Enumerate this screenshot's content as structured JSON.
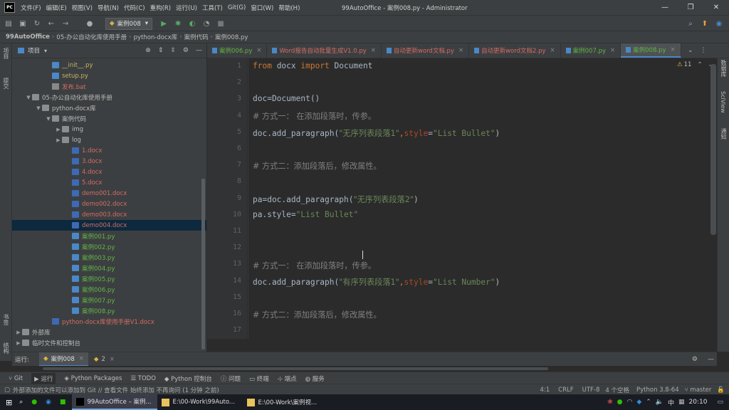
{
  "titlebar": {
    "app_badge": "PC",
    "menu": [
      "文件(F)",
      "编辑(E)",
      "视图(V)",
      "导航(N)",
      "代码(C)",
      "重构(R)",
      "运行(U)",
      "工具(T)",
      "Git(G)",
      "窗口(W)",
      "帮助(H)"
    ],
    "window_title": "99AutoOffice - 案例008.py - Administrator"
  },
  "toolbar": {
    "run_config": "案例008"
  },
  "breadcrumb": [
    "99AutoOffice",
    "05-办公自动化库使用手册",
    "python-docx库",
    "案例代码",
    "案例008.py"
  ],
  "leftstrip": {
    "top_label": "项目",
    "mid_label": "提交",
    "bottom_label1": "书签",
    "bottom_label2": "结构"
  },
  "project": {
    "title": "项目",
    "tree": [
      {
        "label": "__init__.py",
        "indent": 3,
        "type": "py",
        "color": "yellow",
        "arrow": ""
      },
      {
        "label": "setup.py",
        "indent": 3,
        "type": "py",
        "color": "yellow",
        "arrow": ""
      },
      {
        "label": "发布.bat",
        "indent": 3,
        "type": "bat",
        "color": "red",
        "arrow": ""
      },
      {
        "label": "05-办公自动化库使用手册",
        "indent": 1,
        "type": "folder",
        "color": "white",
        "arrow": "▼"
      },
      {
        "label": "python-docx库",
        "indent": 2,
        "type": "folder",
        "color": "white",
        "arrow": "▼"
      },
      {
        "label": "案例代码",
        "indent": 3,
        "type": "folder",
        "color": "white",
        "arrow": "▼"
      },
      {
        "label": "img",
        "indent": 4,
        "type": "folder",
        "color": "white",
        "arrow": "▶"
      },
      {
        "label": "log",
        "indent": 4,
        "type": "folder",
        "color": "white",
        "arrow": "▶"
      },
      {
        "label": "1.docx",
        "indent": 5,
        "type": "doc",
        "color": "red",
        "arrow": ""
      },
      {
        "label": "3.docx",
        "indent": 5,
        "type": "doc",
        "color": "red",
        "arrow": ""
      },
      {
        "label": "4.docx",
        "indent": 5,
        "type": "doc",
        "color": "red",
        "arrow": ""
      },
      {
        "label": "5.docx",
        "indent": 5,
        "type": "doc",
        "color": "red",
        "arrow": ""
      },
      {
        "label": "demo001.docx",
        "indent": 5,
        "type": "doc",
        "color": "red",
        "arrow": ""
      },
      {
        "label": "demo002.docx",
        "indent": 5,
        "type": "doc",
        "color": "red",
        "arrow": ""
      },
      {
        "label": "demo003.docx",
        "indent": 5,
        "type": "doc",
        "color": "red",
        "arrow": ""
      },
      {
        "label": "demo004.docx",
        "indent": 5,
        "type": "doc",
        "color": "red",
        "arrow": "",
        "selected": true
      },
      {
        "label": "案例001.py",
        "indent": 5,
        "type": "py",
        "color": "green",
        "arrow": ""
      },
      {
        "label": "案例002.py",
        "indent": 5,
        "type": "py",
        "color": "green",
        "arrow": ""
      },
      {
        "label": "案例003.py",
        "indent": 5,
        "type": "py",
        "color": "green",
        "arrow": ""
      },
      {
        "label": "案例004.py",
        "indent": 5,
        "type": "py",
        "color": "green",
        "arrow": ""
      },
      {
        "label": "案例005.py",
        "indent": 5,
        "type": "py",
        "color": "green",
        "arrow": ""
      },
      {
        "label": "案例006.py",
        "indent": 5,
        "type": "py",
        "color": "green",
        "arrow": ""
      },
      {
        "label": "案例007.py",
        "indent": 5,
        "type": "py",
        "color": "green",
        "arrow": ""
      },
      {
        "label": "案例008.py",
        "indent": 5,
        "type": "py",
        "color": "green",
        "arrow": ""
      },
      {
        "label": "python-docx库使用手册V1.docx",
        "indent": 3,
        "type": "doc",
        "color": "red",
        "arrow": ""
      },
      {
        "label": "外部库",
        "indent": 0,
        "type": "folder",
        "color": "white",
        "arrow": "▶"
      },
      {
        "label": "临时文件和控制台",
        "indent": 0,
        "type": "folder",
        "color": "white",
        "arrow": "▶"
      }
    ]
  },
  "tabs": [
    {
      "label": "案例006.py",
      "color": "green",
      "active": false
    },
    {
      "label": "Word报告自动批量生成V1.0.py",
      "color": "red",
      "active": false
    },
    {
      "label": "自动更新word文档.py",
      "color": "red",
      "active": false
    },
    {
      "label": "自动更新word文档2.py",
      "color": "red",
      "active": false
    },
    {
      "label": "案例007.py",
      "color": "green",
      "active": false
    },
    {
      "label": "案例008.py",
      "color": "green",
      "active": true
    }
  ],
  "editor": {
    "warning_count": "11",
    "line_numbers": [
      "1",
      "2",
      "3",
      "4",
      "5",
      "6",
      "7",
      "8",
      "9",
      "10",
      "11",
      "12",
      "13",
      "14",
      "15",
      "16",
      "17"
    ]
  },
  "code": {
    "l1_from": "from",
    "l1_mod": " docx ",
    "l1_import": "import",
    "l1_name": " Document",
    "l3": "doc=Document()",
    "l4": "# 方式一： 在添加段落时，传参。",
    "l5_a": "doc.add_paragraph(",
    "l5_s1": "\"无序列表段落1\"",
    "l5_c": ",",
    "l5_p": "style",
    "l5_e": "=",
    "l5_s2": "\"List Bullet\"",
    "l5_z": ")",
    "l7": "# 方式二：添加段落后，修改属性。",
    "l9_a": "pa=doc.add_paragraph(",
    "l9_s": "\"无序列表段落2\"",
    "l9_z": ")",
    "l10_a": "pa.style=",
    "l10_s": "\"List Bullet\"",
    "l13": "# 方式一： 在添加段落时，传参。",
    "l14_a": "doc.add_paragraph(",
    "l14_s1": "\"有序列表段落1\"",
    "l14_c": ",",
    "l14_p": "style",
    "l14_e": "=",
    "l14_s2": "\"List Number\"",
    "l14_z": ")",
    "l16": "# 方式二：添加段落后，修改属性。"
  },
  "rightstrip": {
    "label1": "数据库",
    "label2": "SciView",
    "label3": "通知"
  },
  "runbar": {
    "label": "运行:",
    "tab1": "案例008",
    "tab2": "2"
  },
  "tooltabs": [
    "Git",
    "运行",
    "Python Packages",
    "TODO",
    "Python 控制台",
    "问题",
    "终端",
    "端点",
    "服务"
  ],
  "statusbar": {
    "message": "外部添加的文件可以添加到 Git // 查看文件    始终添加    不再询问 (1 分钟 之前)",
    "position": "4:1",
    "line_sep": "CRLF",
    "encoding": "UTF-8",
    "indent": "4 个空格",
    "interpreter": "Python 3.8-64",
    "branch": "master"
  },
  "taskbar": {
    "items": [
      {
        "label": "99AutoOffice – 案例...",
        "active": true
      },
      {
        "label": "E:\\00-Work\\99Auto...",
        "active": false
      },
      {
        "label": "E:\\00-Work\\案例视...",
        "active": false
      }
    ],
    "ime": "中",
    "time": "20:10"
  }
}
